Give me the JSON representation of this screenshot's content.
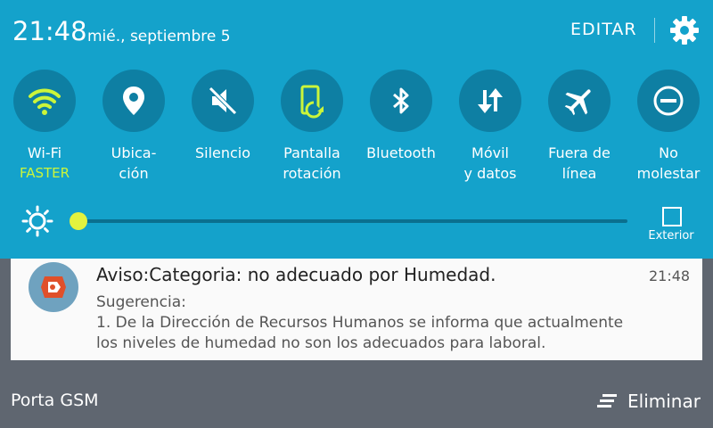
{
  "status": {
    "time": "21:48",
    "date": "mié., septiembre 5",
    "edit_label": "EDITAR"
  },
  "colors": {
    "panel_bg": "#14a2cb",
    "tile_bg": "#0e7fa3",
    "accent_active": "#cbf53a",
    "brightness_knob": "#e3f23e"
  },
  "quick_settings": [
    {
      "icon": "wifi-icon",
      "line1": "Wi-Fi",
      "line2": "FASTER",
      "active": true
    },
    {
      "icon": "location-icon",
      "line1": "Ubica-",
      "line2": "ción"
    },
    {
      "icon": "mute-icon",
      "line1": "Silencio",
      "line2": ""
    },
    {
      "icon": "rotation-icon",
      "line1": "Pantalla",
      "line2": "rotación"
    },
    {
      "icon": "bluetooth-icon",
      "line1": "Bluetooth",
      "line2": ""
    },
    {
      "icon": "mobile-data-icon",
      "line1": "Móvil",
      "line2": "y datos"
    },
    {
      "icon": "airplane-icon",
      "line1": "Fuera de",
      "line2": "línea"
    },
    {
      "icon": "do-not-disturb-icon",
      "line1": "No",
      "line2": "molestar"
    }
  ],
  "brightness": {
    "level": 0.0,
    "outdoor_label": "Exterior"
  },
  "notification": {
    "title": "Aviso:Categoria: no adecuado por Humedad.",
    "time": "21:48",
    "line1": "Sugerencia:",
    "line2": "1.  De la Dirección de Recursos Humanos se informa que actualmente",
    "line3": "los niveles de humedad no son los adecuados para laboral."
  },
  "footer": {
    "carrier": "Porta GSM",
    "clear_label": "Eliminar"
  }
}
